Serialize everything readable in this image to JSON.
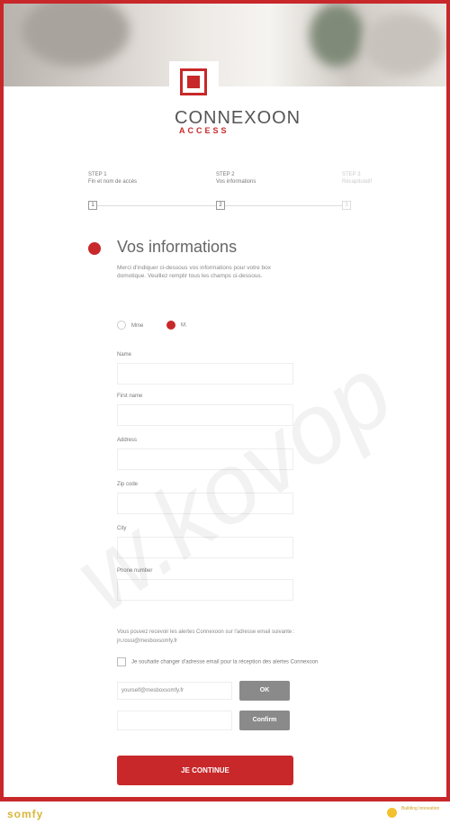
{
  "brand": {
    "name": "CONNEXOON",
    "sub": "ACCESS"
  },
  "steps": [
    {
      "title": "STEP 1",
      "label": "Fin et nom de accès",
      "num": "1"
    },
    {
      "title": "STEP 2",
      "label": "Vos informations",
      "num": "2"
    },
    {
      "title": "STEP 3",
      "label": "Récapitulatif",
      "num": "3"
    }
  ],
  "section": {
    "title": "Vos informations",
    "intro": "Merci d'indiquer ci-dessous vos informations pour votre box domotique. Veuillez remplir tous les champs ci-dessous."
  },
  "gender": {
    "option1": "Mme",
    "option2": "M."
  },
  "fields": {
    "name": "Name",
    "first_name": "First name",
    "address": "Address",
    "zip": "Zip code",
    "city": "City",
    "phone": "Phone number"
  },
  "note": {
    "text": "Vous pouvez recevoir les alertes Connexoon sur l'adresse email suivante :",
    "email": "jn.rossi@mesboxsomfy.fr"
  },
  "checkbox_label": "Je souhaite changer d'adresse email pour la réception des alertes Connexoon",
  "email": {
    "value": "yourself@mesboxsomfy.fr",
    "ok_label": "OK",
    "confirm_label": "Confirm"
  },
  "cta_label": "JE CONTINUE",
  "footer": {
    "logo": "somfy",
    "badge": "Building Innovation"
  },
  "watermark": "w.kovop",
  "colors": {
    "accent": "#c8282a",
    "button_gray": "#8a8a8a"
  }
}
